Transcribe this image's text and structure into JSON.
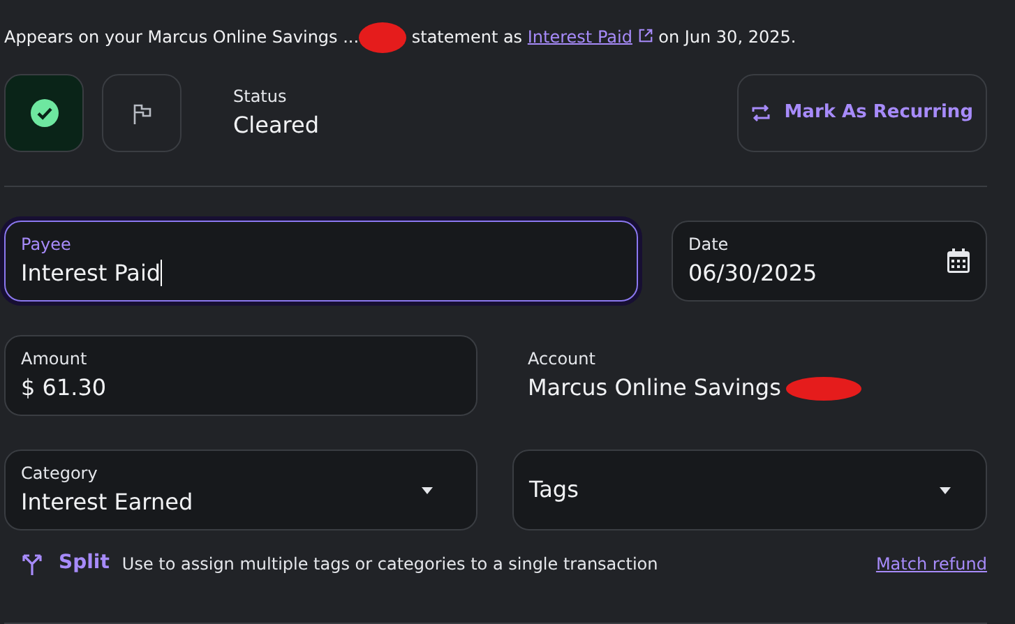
{
  "appears_note": {
    "before": "Appears on your Marcus Online Savings ...",
    "middle": "statement as",
    "link": "Interest Paid",
    "after": "on Jun 30, 2025.",
    "redacted": true
  },
  "status_buttons": [
    {
      "kind": "cleared",
      "selected": true
    },
    {
      "kind": "flag",
      "selected": false
    }
  ],
  "status": {
    "label": "Status",
    "value": "Cleared"
  },
  "recurring_button": {
    "label": "Mark As Recurring"
  },
  "payee": {
    "label": "Payee",
    "value": "Interest Paid",
    "focused": true
  },
  "date": {
    "label": "Date",
    "value": "06/30/2025"
  },
  "amount": {
    "label": "Amount",
    "value": "$ 61.30"
  },
  "account": {
    "label": "Account",
    "value": "Marcus Online Savings",
    "redacted": true
  },
  "category": {
    "label": "Category",
    "value": "Interest Earned"
  },
  "tags": {
    "placeholder": "Tags"
  },
  "split": {
    "label": "Split",
    "hint": "Use to assign multiple tags or categories to a single transaction"
  },
  "match_refund": "Match refund"
}
